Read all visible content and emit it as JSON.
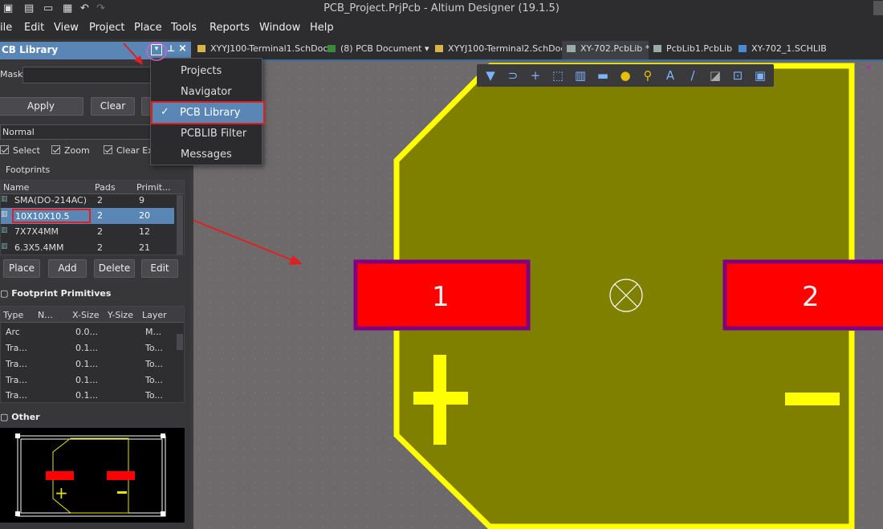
{
  "window": {
    "title": "PCB_Project.PrjPcb - Altium Designer (19.1.5)"
  },
  "menu": [
    "ile",
    "Edit",
    "View",
    "Project",
    "Place",
    "Tools",
    "Reports",
    "Window",
    "Help"
  ],
  "tabs": [
    {
      "label": "XYYJ100-Terminal1.SchDoc"
    },
    {
      "label": "(8) PCB Document"
    },
    {
      "label": "XYYJ100-Terminal2.SchDoc"
    },
    {
      "label": "XY-702.PcbLib *"
    },
    {
      "label": "PcbLib1.PcbLib"
    },
    {
      "label": "XY-702_1.SCHLIB"
    }
  ],
  "panel": {
    "title": "CB Library",
    "mask_label": "Mask",
    "mask_value": "",
    "apply_label": "Apply",
    "clear_label": "Clear",
    "mode": "Normal",
    "checks": [
      "Select",
      "Zoom",
      "Clear Ex"
    ],
    "footprints_label": "Footprints",
    "fp_cols": [
      "Name",
      "Pads",
      "Primit..."
    ],
    "footprints": [
      {
        "name": "SMA(DO-214AC)",
        "pads": "2",
        "prims": "9"
      },
      {
        "name": "10X10X10.5",
        "pads": "2",
        "prims": "20"
      },
      {
        "name": "7X7X4MM",
        "pads": "2",
        "prims": "12"
      },
      {
        "name": "6.3X5.4MM",
        "pads": "2",
        "prims": "21"
      }
    ],
    "buttons": [
      "Place",
      "Add",
      "Delete",
      "Edit"
    ],
    "primitives_label": "Footprint Primitives",
    "prim_cols": [
      "Type",
      "N...",
      "X-Size",
      "Y-Size",
      "Layer"
    ],
    "primitives": [
      {
        "type": "Arc",
        "x": "0.0...",
        "layer": "M..."
      },
      {
        "type": "Tra...",
        "x": "0.1...",
        "layer": "To..."
      },
      {
        "type": "Tra...",
        "x": "0.1...",
        "layer": "To..."
      },
      {
        "type": "Tra...",
        "x": "0.1...",
        "layer": "To..."
      },
      {
        "type": "Tra...",
        "x": "0.1...",
        "layer": "To..."
      }
    ],
    "other_label": "Other"
  },
  "dropdown": {
    "items": [
      {
        "label": "Projects",
        "checked": false
      },
      {
        "label": "Navigator",
        "checked": false
      },
      {
        "label": "PCB Library",
        "checked": true
      },
      {
        "label": "PCBLIB Filter",
        "checked": false
      },
      {
        "label": "Messages",
        "checked": false
      }
    ],
    "check_mark": "✓"
  },
  "pads": {
    "pad1": "1",
    "pad2": "2",
    "plus": "+",
    "minus": "−"
  },
  "colors": {
    "pad": "#ff0000",
    "pad_border": "#800080",
    "outline": "#ffff00",
    "body": "#808000",
    "annotation": "#e02020",
    "accent": "#5a86b5"
  }
}
